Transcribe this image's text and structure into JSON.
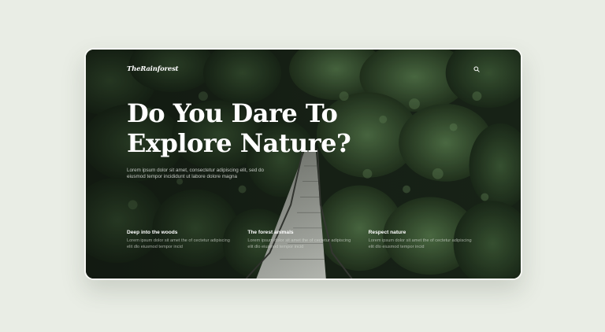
{
  "site": {
    "logo": "TheRainforest"
  },
  "nav": {
    "search_icon": "search-icon"
  },
  "hero": {
    "title_line1": "Do You Dare To",
    "title_line2": "Explore Nature?",
    "text": "Lorem ipsum dolor sit amet, consectetur adipiscing elit, sed do eiusmod tempor incididunt ut labore dolore magna"
  },
  "features": [
    {
      "title": "Deep into the woods",
      "text": "Lorem ipsum dolor sit amet the of cectetur adipiscing elit dlo eiusmod tempor incid"
    },
    {
      "title": "The forest animals",
      "text": "Lorem ipsum dolor sit amet the of cectetur adipiscing elit dlo eiusmod tempor incid"
    },
    {
      "title": "Respect nature",
      "text": "Lorem ipsum dolor sit amet the of cectetur adipiscing elit dlo eiusmod tempor incid"
    }
  ],
  "colors": {
    "page_background": "#e9ede5",
    "forest_dark": "#1a2219",
    "text_light": "#ffffff"
  }
}
